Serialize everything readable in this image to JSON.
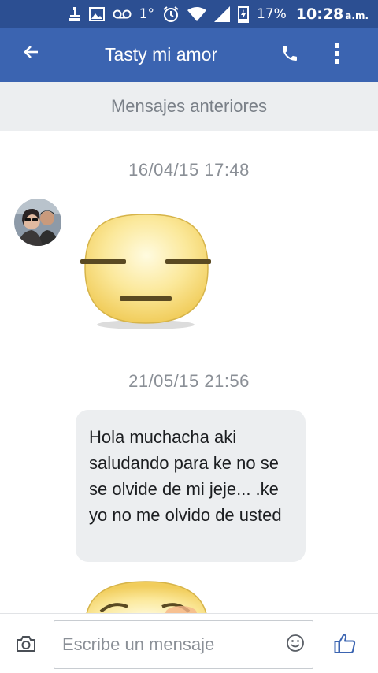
{
  "status_bar": {
    "temperature": "1°",
    "battery_percent": "17%",
    "time": "10:28",
    "ampm": "a.m.",
    "icons": [
      "usb-debug-icon",
      "image-icon",
      "voicemail-icon",
      "alarm-icon",
      "wifi-icon",
      "signal-icon",
      "battery-charging-icon"
    ]
  },
  "header": {
    "title": "Tasty mi amor",
    "icons": [
      "back-arrow-icon",
      "phone-icon",
      "more-vert-icon"
    ]
  },
  "older_messages_label": "Mensajes anteriores",
  "conversation": {
    "timestamp_1": "16/04/15 17:48",
    "timestamp_2": "21/05/15 21:56",
    "message_text": "Hola muchacha aki saludando para ke no se se olvide de mi jeje... .ke yo no me olvido de usted"
  },
  "composer": {
    "placeholder": "Escribe un mensaje",
    "icons": [
      "camera-icon",
      "emoji-icon",
      "thumbs-up-icon"
    ]
  },
  "colors": {
    "status_bar": "#2c4f92",
    "app_bar": "#3b64b1",
    "bubble": "#eceef0",
    "accent": "#3b64b1"
  }
}
